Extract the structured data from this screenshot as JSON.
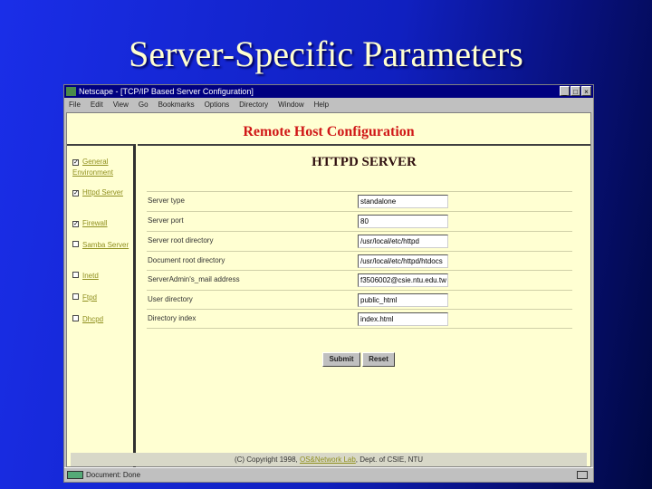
{
  "slide_title": "Server-Specific Parameters",
  "window": {
    "title": "Netscape - [TCP/IP Based Server Configuration]",
    "controls": [
      "_",
      "□",
      "×"
    ]
  },
  "menu": [
    "File",
    "Edit",
    "View",
    "Go",
    "Bookmarks",
    "Options",
    "Directory",
    "Window",
    "Help"
  ],
  "page_heading": "Remote Host Configuration",
  "sidebar": [
    {
      "label": "General Environment",
      "checked": true
    },
    {
      "label": "Httpd Server",
      "checked": true
    },
    {
      "label": "Firewall",
      "checked": true
    },
    {
      "label": "Samba Server",
      "checked": false
    },
    {
      "label": "Inetd",
      "checked": false
    },
    {
      "label": "Ftpd",
      "checked": false
    },
    {
      "label": "Dhcpd",
      "checked": false
    }
  ],
  "form": {
    "title": "HTTPD SERVER",
    "fields": [
      {
        "label": "Server type",
        "value": "standalone"
      },
      {
        "label": "Server port",
        "value": "80"
      },
      {
        "label": "Server root directory",
        "value": "/usr/local/etc/httpd"
      },
      {
        "label": "Document root directory",
        "value": "/usr/local/etc/httpd/htdocs"
      },
      {
        "label": "ServerAdmin's_mail address",
        "value": "f3506002@csie.ntu.edu.tw"
      },
      {
        "label": "User directory",
        "value": "public_html"
      },
      {
        "label": "Directory index",
        "value": "index.html"
      }
    ],
    "submit": "Submit",
    "reset": "Reset"
  },
  "footer": {
    "prefix": "(C) Copyright 1998,",
    "link": "OS&Network Lab",
    "suffix": ", Dept. of CSIE, NTU"
  },
  "status": "Document: Done"
}
